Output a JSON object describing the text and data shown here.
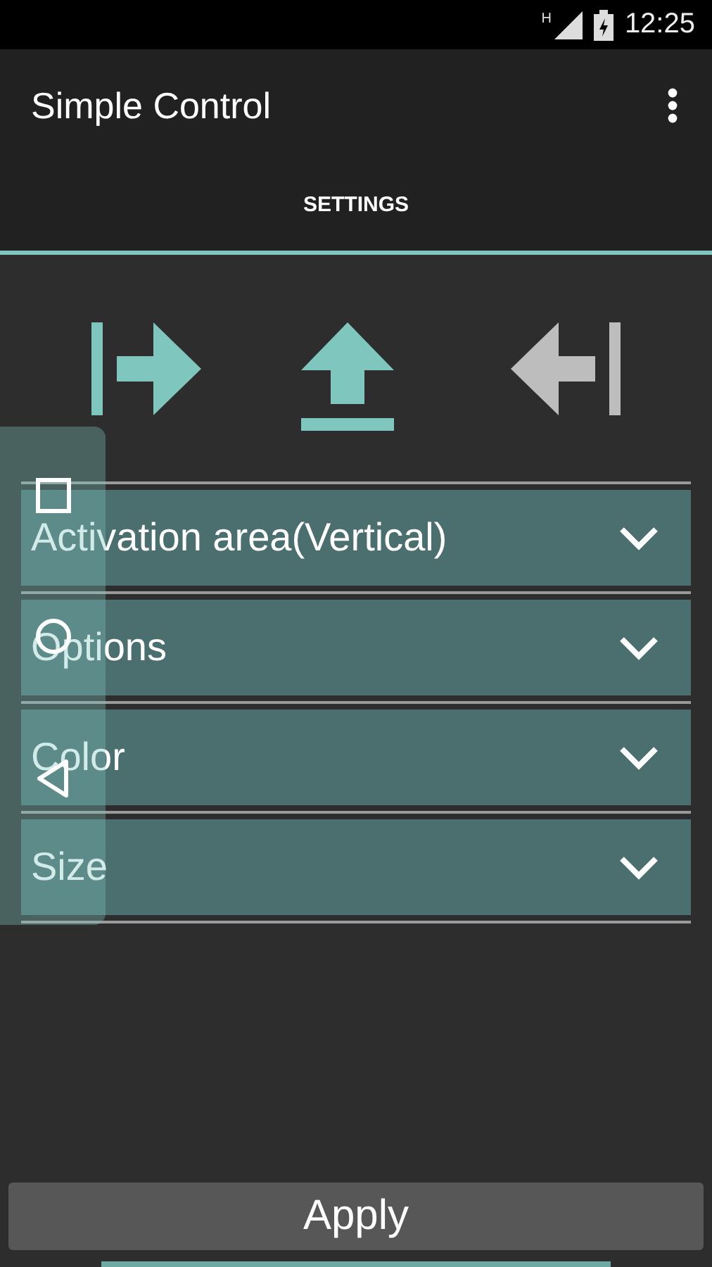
{
  "status_bar": {
    "network": "H",
    "time": "12:25"
  },
  "app_bar": {
    "title": "Simple Control"
  },
  "tabs": [
    {
      "label": "SETTINGS",
      "selected": true
    }
  ],
  "positions": [
    {
      "kind": "right",
      "selected": true
    },
    {
      "kind": "bottom",
      "selected": true
    },
    {
      "kind": "left",
      "selected": false
    }
  ],
  "sections": [
    {
      "label": "Activation area(Vertical)",
      "expanded": false
    },
    {
      "label": "Options",
      "expanded": false
    },
    {
      "label": "Color",
      "expanded": false
    },
    {
      "label": "Size",
      "expanded": false
    }
  ],
  "floating_panel": {
    "buttons": [
      {
        "kind": "recents"
      },
      {
        "kind": "home"
      },
      {
        "kind": "back"
      }
    ]
  },
  "apply_button": {
    "label": "Apply"
  }
}
